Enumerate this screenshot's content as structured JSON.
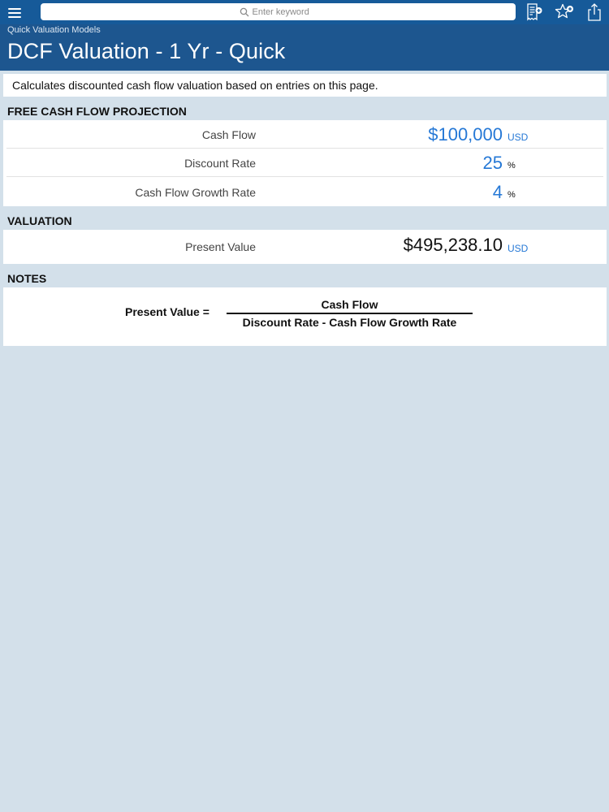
{
  "search": {
    "placeholder": "Enter keyword"
  },
  "header": {
    "breadcrumb": "Quick Valuation Models",
    "title": "DCF Valuation - 1 Yr - Quick"
  },
  "description": "Calculates discounted cash flow valuation based on entries on this page.",
  "projection": {
    "heading": "FREE CASH FLOW PROJECTION",
    "rows": [
      {
        "label": "Cash Flow",
        "value": "$100,000",
        "unit": "USD"
      },
      {
        "label": "Discount Rate",
        "value": "25",
        "unit": "%"
      },
      {
        "label": "Cash Flow Growth Rate",
        "value": "4",
        "unit": "%"
      }
    ]
  },
  "valuation": {
    "heading": "VALUATION",
    "label": "Present Value",
    "value": "$495,238.10",
    "unit": "USD"
  },
  "notes": {
    "heading": "NOTES",
    "lhs": "Present Value =",
    "numerator": "Cash Flow",
    "denominator": "Discount Rate - Cash Flow Growth Rate"
  },
  "colors": {
    "topbar": "#165a99",
    "header": "#1d568f",
    "accent": "#2578d6",
    "background": "#d3e0ea"
  },
  "icons": [
    "menu-icon",
    "search-icon",
    "report-add-icon",
    "favorite-add-icon",
    "share-icon"
  ]
}
